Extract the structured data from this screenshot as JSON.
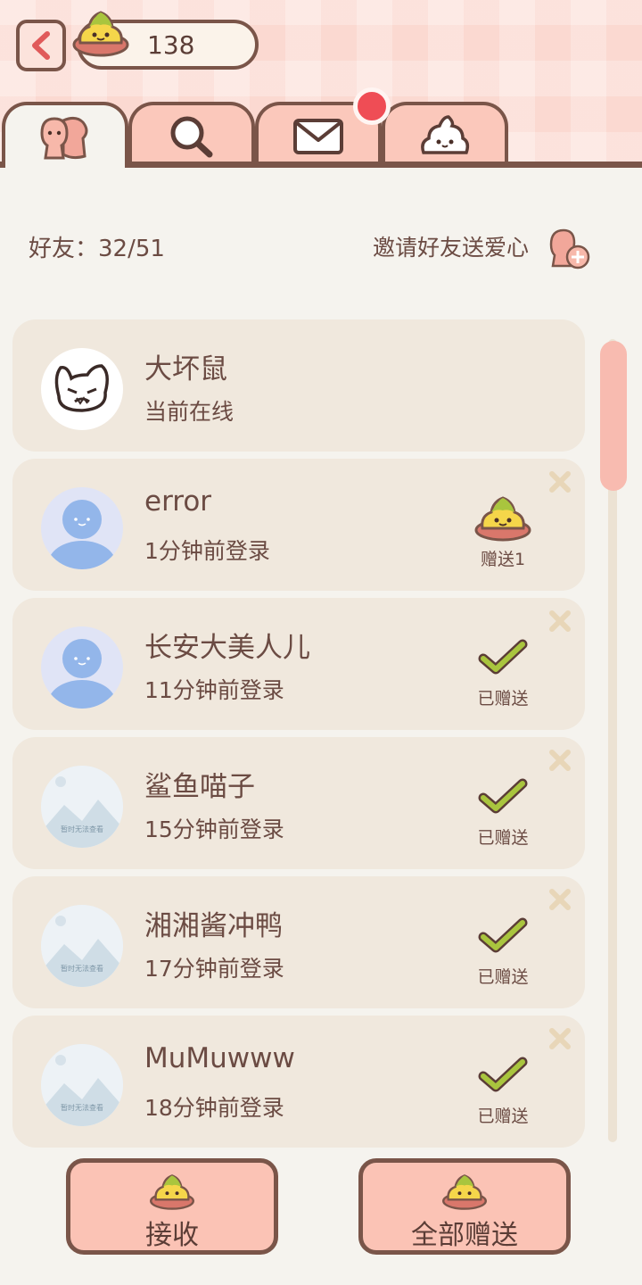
{
  "header": {
    "coins": "138",
    "tabs": [
      {
        "name": "friends",
        "icon": "friends-icon",
        "active": true
      },
      {
        "name": "search",
        "icon": "search-icon",
        "active": false
      },
      {
        "name": "mail",
        "icon": "mail-icon",
        "active": false,
        "badge": true
      },
      {
        "name": "poop",
        "icon": "poop-icon",
        "active": false
      }
    ]
  },
  "friends": {
    "count_label": "好友：32/51",
    "invite_label": "邀请好友送爱心"
  },
  "list": [
    {
      "name": "大坏鼠",
      "status": "当前在线",
      "avatar": "rabbit-avatar",
      "action": "none"
    },
    {
      "name": "error",
      "status": "1分钟前登录",
      "avatar": "default-avatar",
      "action": "gift",
      "action_label": "赠送1"
    },
    {
      "name": "长安大美人儿",
      "status": "11分钟前登录",
      "avatar": "default-avatar",
      "action": "sent",
      "action_label": "已赠送"
    },
    {
      "name": "鲨鱼喵子",
      "status": "15分钟前登录",
      "avatar": "unavailable-avatar",
      "avatar_text": "暂时无法查看",
      "action": "sent",
      "action_label": "已赠送"
    },
    {
      "name": "湘湘酱冲鸭",
      "status": "17分钟前登录",
      "avatar": "unavailable-avatar",
      "avatar_text": "暂时无法查看",
      "action": "sent",
      "action_label": "已赠送"
    },
    {
      "name": "MuMuwww",
      "status": "18分钟前登录",
      "avatar": "unavailable-avatar",
      "avatar_text": "暂时无法查看",
      "action": "sent",
      "action_label": "已赠送"
    }
  ],
  "buttons": {
    "receive": "接收",
    "send_all": "全部赠送"
  },
  "colors": {
    "accent": "#fbc3b5",
    "border": "#7a5549",
    "card": "#f0e8dd",
    "check": "#a9c53e",
    "notify": "#ef4d55"
  }
}
